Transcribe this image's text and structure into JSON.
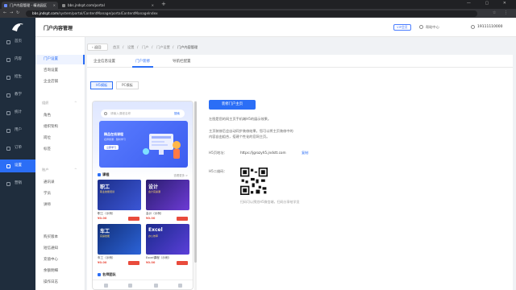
{
  "browser": {
    "tabs": [
      {
        "title": "门户内容管理 - 精选园区"
      },
      {
        "title": "bbs.jndspt.com/portal"
      }
    ],
    "url_host": "bbs.jndspt.com",
    "url_path": "/system/portal/ContentManage/portalContentManageIndex"
  },
  "sidebar_main": {
    "items": [
      {
        "label": "首页"
      },
      {
        "label": "内容"
      },
      {
        "label": "招生"
      },
      {
        "label": "教学"
      },
      {
        "label": "统计"
      },
      {
        "label": "用户"
      },
      {
        "label": "订单"
      },
      {
        "label": "设置"
      },
      {
        "label": "营销"
      }
    ],
    "active_index": 7
  },
  "sidebar_sub": {
    "groups": [
      {
        "title": "",
        "items": [
          "门户设置",
          "咨询设置",
          "企业店铺"
        ]
      },
      {
        "title": "组织",
        "items": [
          "角色",
          "组织架构",
          "岗位",
          "标签"
        ]
      },
      {
        "title": "账户",
        "items": [
          "通讯录",
          "学员",
          "讲师"
        ]
      },
      {
        "title": "",
        "items": [
          "购买版本",
          "短信通知",
          "充值中心",
          "余额明细",
          "操作日志"
        ]
      }
    ],
    "active_item": "门户设置"
  },
  "header": {
    "title": "门户内容管理",
    "badge": "VIP会员",
    "help": "帮助中心",
    "phone": "19111110000"
  },
  "breadcrumb": {
    "back": "返回",
    "items": [
      "首页",
      "设置",
      "门户",
      "门户设置",
      "门户内容管理"
    ]
  },
  "tabs": {
    "items": [
      "企业信息设置",
      "门户装修",
      "导航栏配置"
    ],
    "active_index": 1
  },
  "segments": {
    "items": [
      "H5模板",
      "PC模板"
    ],
    "active_index": 0
  },
  "phone": {
    "search_placeholder": "请输入课程名称",
    "search_btn": "搜索",
    "banner_title": "精品在线课程",
    "banner_sub": "名师授课 · 随时学习",
    "banner_btn": "立即学习",
    "section1": "课程",
    "more": "查看更多 >",
    "courses": [
      {
        "cap": "职工",
        "sub": "职业技能培训",
        "name": "职工（示例）",
        "price": "¥0.00"
      },
      {
        "cap": "设计",
        "sub": "会计实操课",
        "name": "会计（示例）",
        "price": "¥0.00"
      },
      {
        "cap": "车工",
        "sub": "实操技能",
        "name": "车工（示例）",
        "price": "¥0.00"
      },
      {
        "cap": "Excel",
        "sub": "办公效率",
        "name": "Excel课程（示例）",
        "price": "¥0.00"
      }
    ],
    "section2": "名师团队"
  },
  "panel": {
    "button": "装修门户主页",
    "desc1": "左图是您的网主页手机端H5的展示效果。",
    "desc2": "主页装修后会自动同步装修结果，您可以将主页装修中的",
    "desc3": "内容自由组合，搭建个性化的官网主页。",
    "h5_label": "H5页地址：",
    "h5_url": "https://jgrozyh5.jndstt.com",
    "copy": "复制",
    "qr_label": "H5二维码：",
    "qr_tip": "扫码可以预览H5微信端，扫码分享给学员"
  },
  "colors": {
    "accent": "#2b6ef6",
    "sidebar_dark": "#1f2d3d",
    "price": "#e94b3c"
  }
}
